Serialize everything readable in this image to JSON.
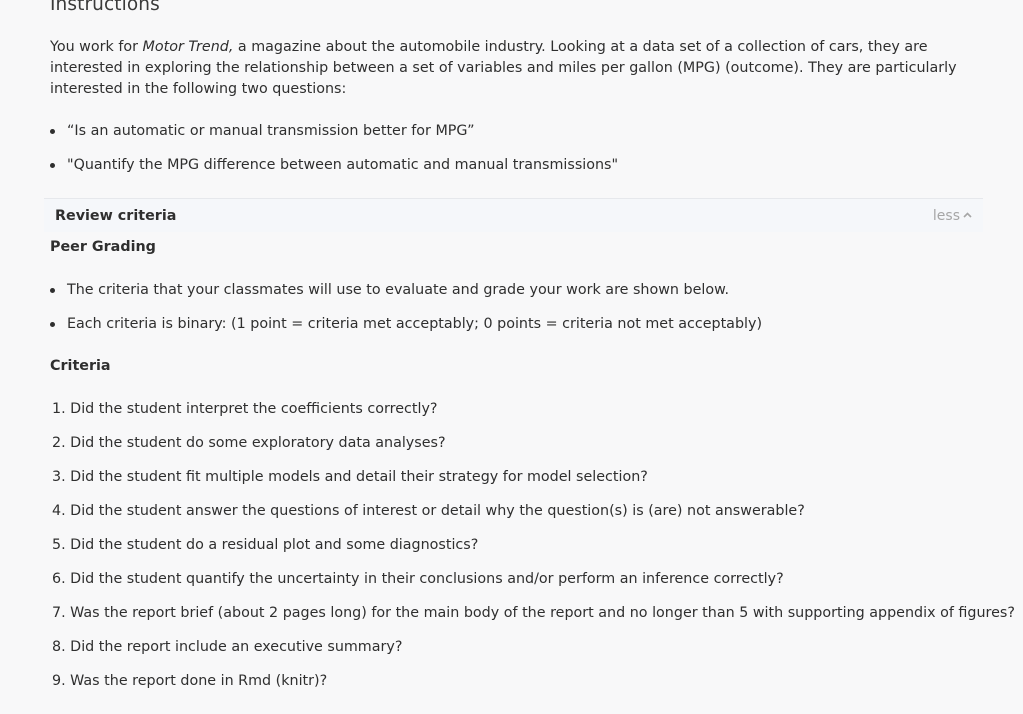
{
  "instructions": {
    "heading": "Instructions",
    "intro_before": "You work for ",
    "intro_magazine": "Motor Trend,",
    "intro_after": " a magazine about the automobile industry. Looking at a data set of a collection of cars, they are interested in exploring the relationship between a set of variables and miles per gallon (MPG) (outcome). They are particularly interested in the following two questions:",
    "questions": [
      "“Is an automatic or manual transmission better for MPG”",
      "\"Quantify the MPG difference between automatic and manual transmissions\""
    ]
  },
  "review": {
    "title": "Review criteria",
    "toggle_label": "less",
    "toggle_icon": "chevron-up-icon",
    "peer_heading": "Peer Grading",
    "peer_points": [
      "The criteria that your classmates will use to evaluate and grade your work are shown below.",
      "Each criteria is binary: (1 point = criteria met acceptably; 0 points = criteria not met acceptably)"
    ],
    "criteria_heading": "Criteria",
    "criteria": [
      "1. Did the student interpret the coefficients correctly?",
      "2. Did the student do some exploratory data analyses?",
      "3. Did the student fit multiple models and detail their strategy for model selection?",
      "4. Did the student answer the questions of interest or detail why the question(s) is (are) not answerable?",
      "5. Did the student do a residual plot and some diagnostics?",
      "6. Did the student quantify the uncertainty in their conclusions and/or perform an inference correctly?",
      "7. Was the report brief (about 2 pages long) for the main body of the report and no longer than 5 with supporting appendix of figures?",
      "8. Did the report include an executive summary?",
      "9. Was the report done in Rmd (knitr)?"
    ]
  }
}
